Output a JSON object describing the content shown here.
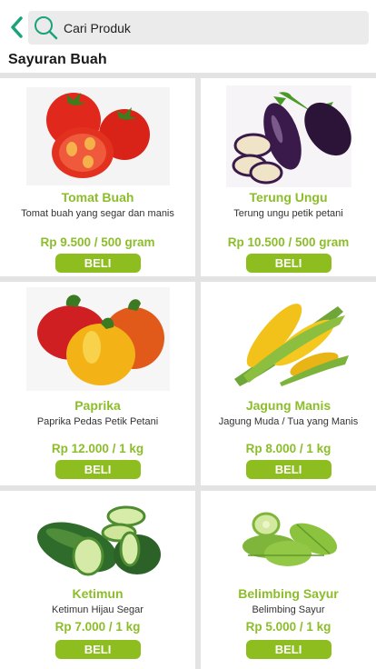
{
  "search": {
    "placeholder": "Cari Produk"
  },
  "page": {
    "title": "Sayuran Buah"
  },
  "buy_label": "BELI",
  "colors": {
    "accent": "#8dbd1f",
    "back_arrow": "#1aa37a",
    "search_bg": "#ebebeb"
  },
  "products": [
    {
      "name": "Tomat Buah",
      "desc": "Tomat buah yang segar dan manis",
      "price": "Rp 9.500 / 500 gram",
      "icon": "tomato-image"
    },
    {
      "name": "Terung Ungu",
      "desc": "Terung ungu petik petani",
      "price": "Rp 10.500 / 500 gram",
      "icon": "eggplant-image"
    },
    {
      "name": "Paprika",
      "desc": "Paprika Pedas Petik Petani",
      "price": "Rp 12.000 / 1 kg",
      "icon": "paprika-image"
    },
    {
      "name": "Jagung Manis",
      "desc": "Jagung Muda / Tua yang Manis",
      "price": "Rp 8.000 / 1 kg",
      "icon": "corn-image"
    },
    {
      "name": "Ketimun",
      "desc": "Ketimun Hijau Segar",
      "price": "Rp 7.000 / 1 kg",
      "icon": "cucumber-image"
    },
    {
      "name": "Belimbing Sayur",
      "desc": "Belimbing Sayur",
      "price": "Rp 5.000 / 1 kg",
      "icon": "star-fruit-image"
    }
  ]
}
